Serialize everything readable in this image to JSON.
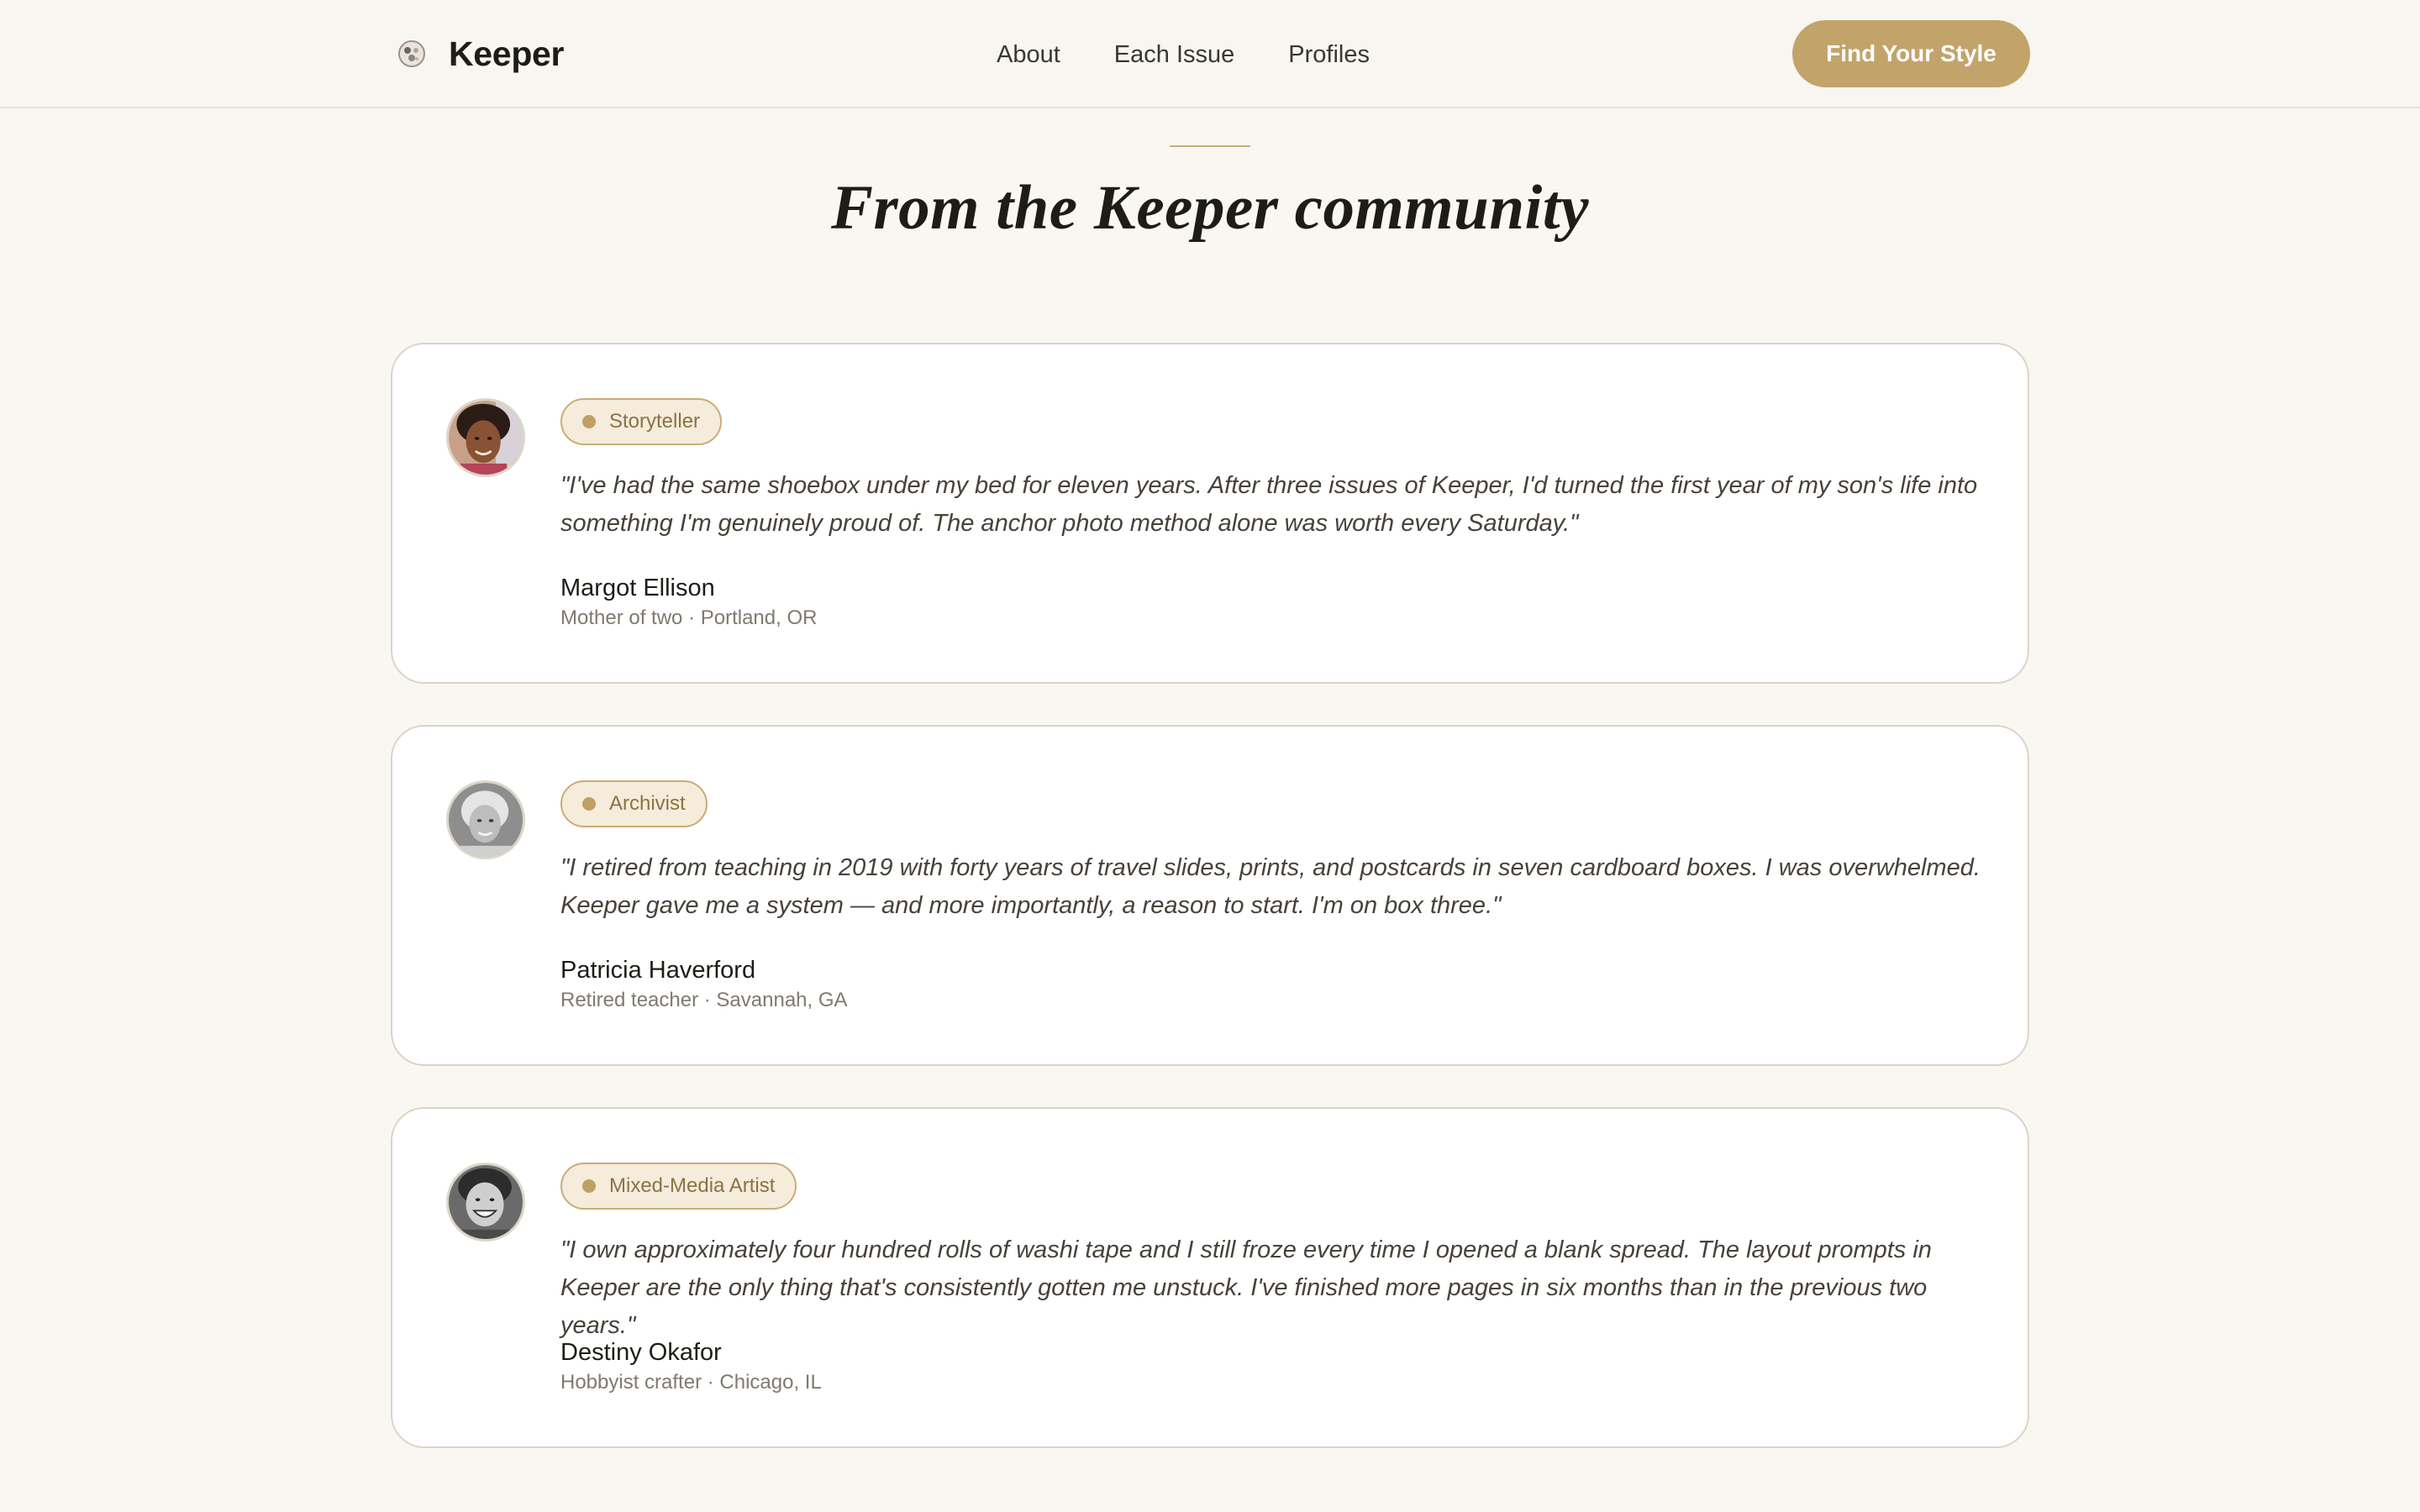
{
  "brand": {
    "name": "Keeper"
  },
  "nav": {
    "items": [
      {
        "label": "About"
      },
      {
        "label": "Each Issue"
      },
      {
        "label": "Profiles"
      }
    ],
    "cta_label": "Find Your Style"
  },
  "section": {
    "title": "From the Keeper community"
  },
  "testimonials": [
    {
      "badge": "Storyteller",
      "quote": "\"I've had the same shoebox under my bed for eleven years. After three issues of Keeper, I'd turned the first year of my son's life into something I'm genuinely proud of. The anchor photo method alone was worth every Saturday.\"",
      "name": "Margot Ellison",
      "meta": "Mother of two · Portland, OR"
    },
    {
      "badge": "Archivist",
      "quote": "\"I retired from teaching in 2019 with forty years of travel slides, prints, and postcards in seven cardboard boxes. I was overwhelmed. Keeper gave me a system — and more importantly, a reason to start. I'm on box three.\"",
      "name": "Patricia Haverford",
      "meta": "Retired teacher · Savannah, GA"
    },
    {
      "badge": "Mixed-Media Artist",
      "quote": "\"I own approximately four hundred rolls of washi tape and I still froze every time I opened a blank spread. The layout prompts in Keeper are the only thing that's consistently gotten me unstuck. I've finished more pages in six months than in the previous two years.\"",
      "name": "Destiny Okafor",
      "meta": "Hobbyist crafter · Chicago, IL"
    }
  ],
  "colors": {
    "accent": "#c2a46b",
    "background": "#f9f7f2",
    "badge_fill": "#f5ecdb",
    "badge_text": "#8a7344"
  }
}
